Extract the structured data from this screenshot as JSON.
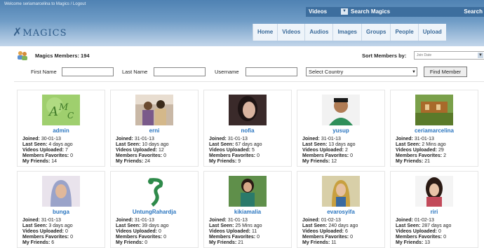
{
  "header": {
    "welcome": "Welcome seriamarcelina to Magics  /  Logout",
    "search": {
      "category": "Videos",
      "input": "Search Magics",
      "button": "Search"
    },
    "logo_text": "MAGICS",
    "nav": [
      "Home",
      "Videos",
      "Audios",
      "Images",
      "Groups",
      "People",
      "Upload"
    ]
  },
  "members": {
    "title": "Magics Members: 194",
    "sort_label": "Sort Members by:",
    "sort_value": "Join Date"
  },
  "filter": {
    "first_name_label": "First Name",
    "last_name_label": "Last Name",
    "username_label": "Username",
    "country_value": "Select Country",
    "button": "Find Member"
  },
  "labels": {
    "joined": "Joined:",
    "last_seen": "Last Seen:",
    "videos": "Videos Uploaded:",
    "favorites": "Members Favorites:",
    "friends": "My Friends:"
  },
  "cards": [
    {
      "name": "admin",
      "joined": "30-01-13",
      "last_seen": "4 days ago",
      "videos": "7",
      "favorites": "0",
      "friends": "14",
      "photo": "logo-am"
    },
    {
      "name": "erni",
      "joined": "31-01-13",
      "last_seen": "10 days ago",
      "videos": "12",
      "favorites": "0",
      "friends": "24",
      "photo": "couple"
    },
    {
      "name": "nofia",
      "joined": "31-01-13",
      "last_seen": "67 days ago",
      "videos": "5",
      "favorites": "0",
      "friends": "9",
      "photo": "girl-dark"
    },
    {
      "name": "yusup",
      "joined": "31-01-13",
      "last_seen": "13 days ago",
      "videos": "2",
      "favorites": "0",
      "friends": "12",
      "photo": "man"
    },
    {
      "name": "ceriamarcelina",
      "joined": "31-01-13",
      "last_seen": "2 Mins ago",
      "videos": "29",
      "favorites": "2",
      "friends": "21",
      "photo": "scene"
    },
    {
      "name": "bunga",
      "joined": "31-01-13",
      "last_seen": "3 days ago",
      "videos": "0",
      "favorites": "0",
      "friends": "6",
      "photo": "hijab"
    },
    {
      "name": "UntungRahardja",
      "joined": "31-01-13",
      "last_seen": "39 days ago",
      "videos": "0",
      "favorites": "0",
      "friends": "0",
      "photo": "snake"
    },
    {
      "name": "kikiamalia",
      "joined": "31-01-13",
      "last_seen": "25 Mins ago",
      "videos": "11",
      "favorites": "0",
      "friends": "21",
      "photo": "girl-green"
    },
    {
      "name": "evarosyifa",
      "joined": "01-02-13",
      "last_seen": "240 days ago",
      "videos": "6",
      "favorites": "0",
      "friends": "11",
      "photo": "hijab-colorful"
    },
    {
      "name": "riri",
      "joined": "01-02-13",
      "last_seen": "287 days ago",
      "videos": "0",
      "favorites": "0",
      "friends": "13",
      "photo": "girl-portrait"
    }
  ]
}
